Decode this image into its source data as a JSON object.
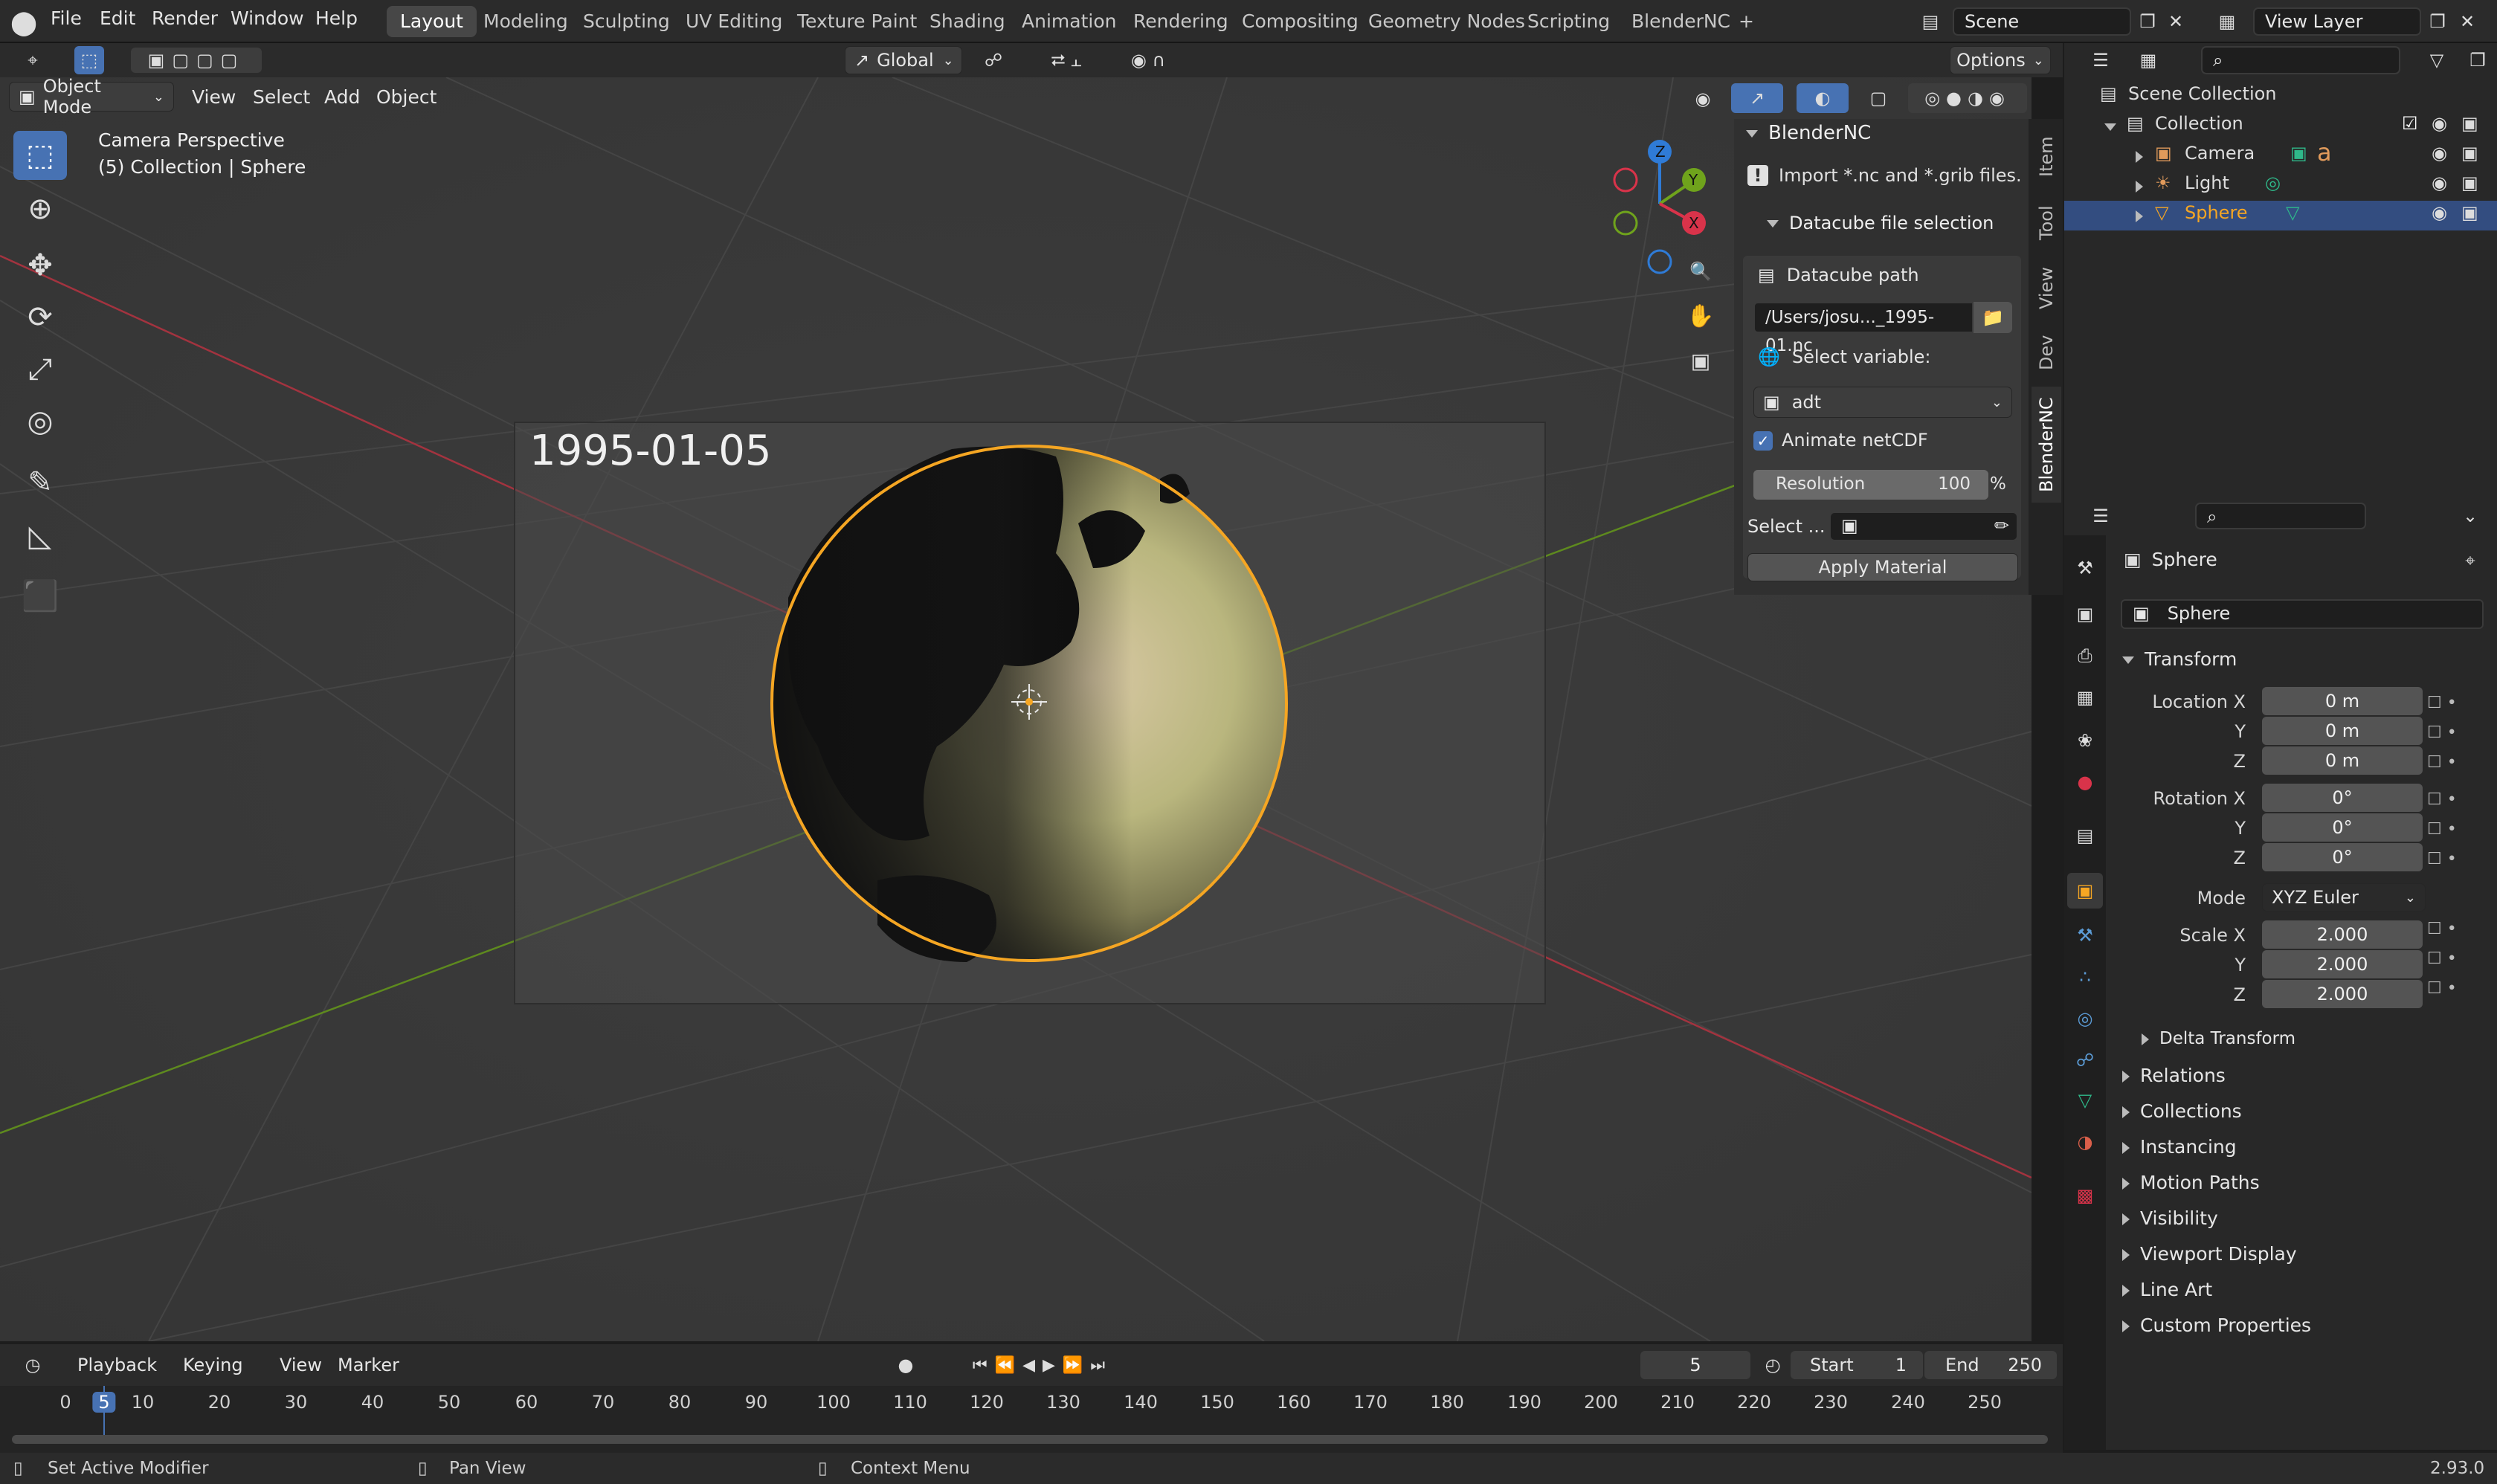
{
  "topbar": {
    "menus": [
      "File",
      "Edit",
      "Render",
      "Window",
      "Help"
    ],
    "workspaces": [
      "Layout",
      "Modeling",
      "Sculpting",
      "UV Editing",
      "Texture Paint",
      "Shading",
      "Animation",
      "Rendering",
      "Compositing",
      "Geometry Nodes",
      "Scripting",
      "BlenderNC"
    ],
    "active_workspace": "Layout",
    "add_tab": "+",
    "scene": "Scene",
    "view_layer": "View Layer"
  },
  "tool_header": {
    "orientation": "Global",
    "options": "Options"
  },
  "viewport_header": {
    "mode": "Object Mode",
    "menus": [
      "View",
      "Select",
      "Add",
      "Object"
    ]
  },
  "viewport": {
    "camera_label": "Camera Perspective",
    "collection_label": "(5) Collection | Sphere",
    "overlay_date": "1995-01-05",
    "gizmo_axes": [
      "X",
      "Y",
      "Z"
    ]
  },
  "npanel": {
    "title": "BlenderNC",
    "description": "Import *.nc and *.grib files.",
    "subpanel": "Datacube file selection",
    "datacube_path_label": "Datacube path",
    "datacube_path_value": "/Users/josu..._1995-01.nc",
    "select_variable_label": "Select variable:",
    "variable_value": "adt",
    "animate_label": "Animate netCDF",
    "animate_checked": true,
    "resolution_label": "Resolution",
    "resolution_value": "100",
    "resolution_unit": "%",
    "select_label": "Select ...",
    "apply_button": "Apply Material",
    "tabs": [
      "Item",
      "Tool",
      "View",
      "Dev",
      "BlenderNC"
    ],
    "active_tab": "BlenderNC"
  },
  "outliner": {
    "root": "Scene Collection",
    "collection": "Collection",
    "items": [
      {
        "name": "Camera",
        "selected": false
      },
      {
        "name": "Light",
        "selected": false
      },
      {
        "name": "Sphere",
        "selected": true
      }
    ]
  },
  "properties": {
    "object_name": "Sphere",
    "object_field": "Sphere",
    "transform_title": "Transform",
    "location_label": "Location X",
    "rotation_label": "Rotation X",
    "scale_label": "Scale X",
    "y_label": "Y",
    "z_label": "Z",
    "location": [
      "0 m",
      "0 m",
      "0 m"
    ],
    "rotation": [
      "0°",
      "0°",
      "0°"
    ],
    "mode_label": "Mode",
    "mode_value": "XYZ Euler",
    "scale": [
      "2.000",
      "2.000",
      "2.000"
    ],
    "delta_transform": "Delta Transform",
    "collapsed_sections": [
      "Relations",
      "Collections",
      "Instancing",
      "Motion Paths",
      "Visibility",
      "Viewport Display",
      "Line Art",
      "Custom Properties"
    ]
  },
  "timeline": {
    "menus": [
      "Playback",
      "Keying",
      "View",
      "Marker"
    ],
    "current_frame": "5",
    "start_label": "Start",
    "start_value": "1",
    "end_label": "End",
    "end_value": "250",
    "ticks": [
      "0",
      "5",
      "10",
      "20",
      "30",
      "40",
      "50",
      "60",
      "70",
      "80",
      "90",
      "100",
      "110",
      "120",
      "130",
      "140",
      "150",
      "160",
      "170",
      "180",
      "190",
      "200",
      "210",
      "220",
      "230",
      "240",
      "250"
    ]
  },
  "statusbar": {
    "left": "Set Active Modifier",
    "middle": "Pan View",
    "right": "Context Menu",
    "version": "2.93.0"
  },
  "colors": {
    "accent": "#4772b3",
    "selection_outline": "#f5a623",
    "axis_x": "#d9334a",
    "axis_y": "#6fa31c",
    "axis_z": "#2f7bd6"
  }
}
